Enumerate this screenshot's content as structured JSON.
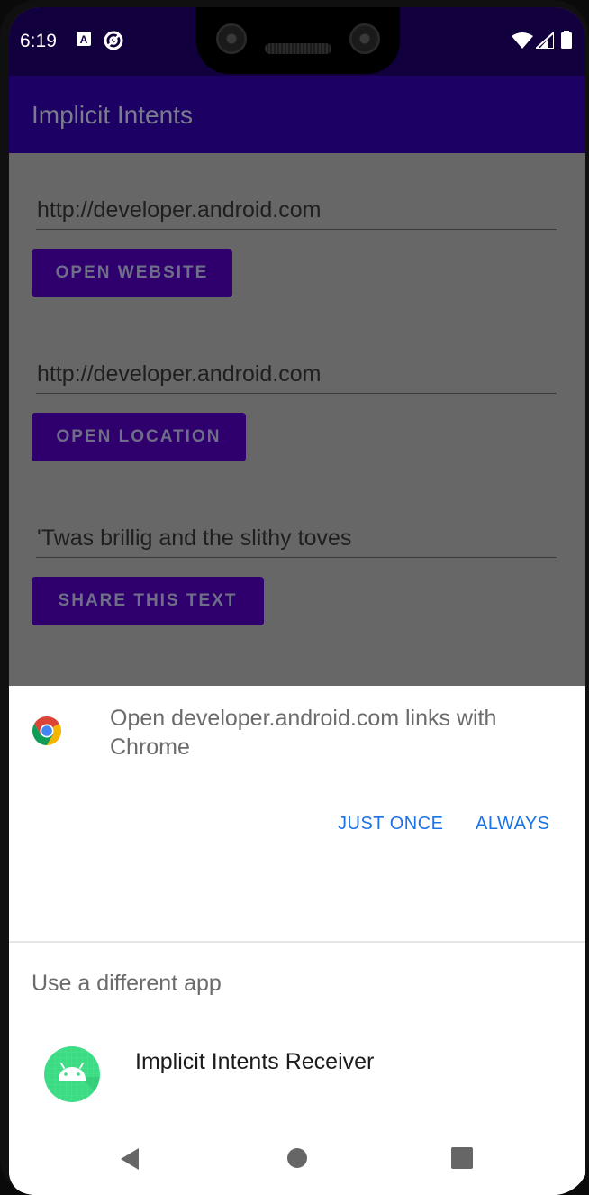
{
  "status_bar": {
    "time": "6:19",
    "icons": [
      "a-notification-icon",
      "at-sign-icon",
      "wifi-icon",
      "cell-signal-icon",
      "battery-icon"
    ]
  },
  "app_bar": {
    "title": "Implicit Intents"
  },
  "main": {
    "website_field": {
      "value": "http://developer.android.com"
    },
    "open_website_label": "OPEN WEBSITE",
    "location_field": {
      "value": "http://developer.android.com"
    },
    "open_location_label": "OPEN LOCATION",
    "share_field": {
      "value": "'Twas brillig and the slithy toves"
    },
    "share_label": "SHARE THIS TEXT"
  },
  "sheet": {
    "title": "Open developer.android.com links with Chrome",
    "just_once_label": "JUST ONCE",
    "always_label": "ALWAYS",
    "different_app_heading": "Use a different app",
    "apps": [
      {
        "name": "Implicit Intents Receiver",
        "icon": "android-robot-icon"
      }
    ]
  },
  "colors": {
    "app_bar": "#1c0064",
    "status_bar": "#11003d",
    "button": "#2f006d",
    "accent": "#1a73e8",
    "android_green": "#3ddc84"
  },
  "nav_bar": {
    "icons": [
      "back-icon",
      "home-icon",
      "recents-icon"
    ]
  }
}
